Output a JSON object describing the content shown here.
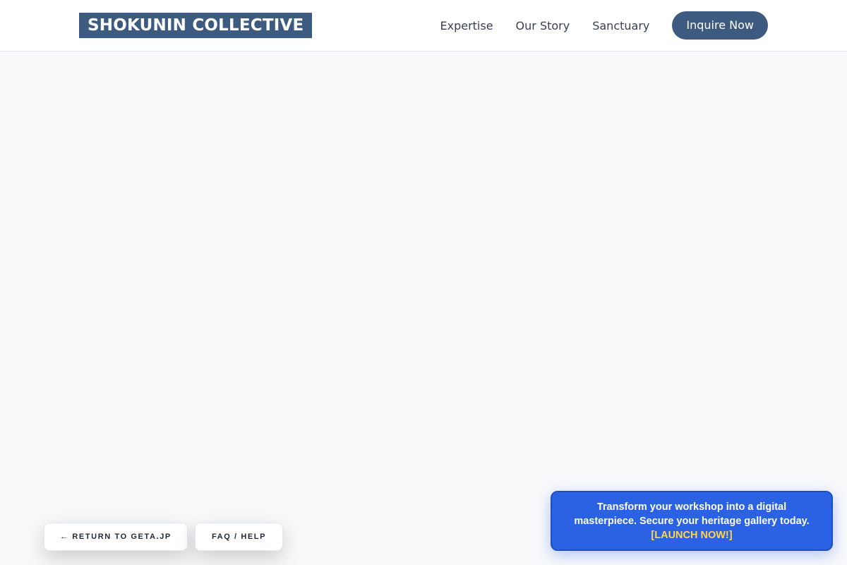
{
  "header": {
    "logo": "SHOKUNIN COLLECTIVE",
    "nav": [
      {
        "label": "Expertise"
      },
      {
        "label": "Our Story"
      },
      {
        "label": "Sanctuary"
      }
    ],
    "cta_label": "Inquire Now"
  },
  "footer": {
    "return_label": "← RETURN TO GETA.JP",
    "faq_label": "FAQ / HELP"
  },
  "promo": {
    "text": "Transform your workshop into a digital masterpiece. Secure your heritage gallery today.",
    "link_label": "[LAUNCH NOW!]"
  },
  "colors": {
    "brand": "#3d5a80",
    "page_background": "#f8f9fb",
    "promo_background": "#2b62e3",
    "promo_link": "#ffd54a"
  }
}
